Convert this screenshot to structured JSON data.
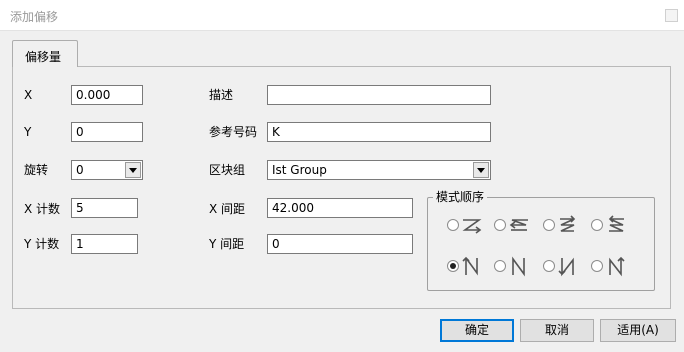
{
  "window": {
    "title": "添加偏移"
  },
  "tabs": [
    {
      "label": "偏移量"
    }
  ],
  "form": {
    "x": {
      "label": "X",
      "value": "0.000"
    },
    "y": {
      "label": "Y",
      "value": "0"
    },
    "rotation": {
      "label": "旋转",
      "value": "0"
    },
    "x_count": {
      "label": "X 计数",
      "value": "5"
    },
    "y_count": {
      "label": "Y 计数",
      "value": "1"
    },
    "description": {
      "label": "描述",
      "value": ""
    },
    "ref_number": {
      "label": "参考号码",
      "value": "K"
    },
    "block_group": {
      "label": "区块组",
      "value": "Ist Group"
    },
    "x_spacing": {
      "label": "X 间距",
      "value": "42.000"
    },
    "y_spacing": {
      "label": "Y 间距",
      "value": "0"
    }
  },
  "pattern_order": {
    "label": "模式顺序",
    "options": [
      {
        "icon": "zigzag-right-icon",
        "checked": false
      },
      {
        "icon": "zigzag-left-icon",
        "checked": false
      },
      {
        "icon": "z-pattern-right-icon",
        "checked": false
      },
      {
        "icon": "z-pattern-left-icon",
        "checked": false
      },
      {
        "icon": "serpentine-up-icon",
        "checked": true
      },
      {
        "icon": "n-pattern-icon",
        "checked": false
      },
      {
        "icon": "serpentine-down-icon",
        "checked": false
      },
      {
        "icon": "n-pattern-up-icon",
        "checked": false
      }
    ]
  },
  "buttons": {
    "ok": "确定",
    "cancel": "取消",
    "apply": "适用(A)"
  }
}
